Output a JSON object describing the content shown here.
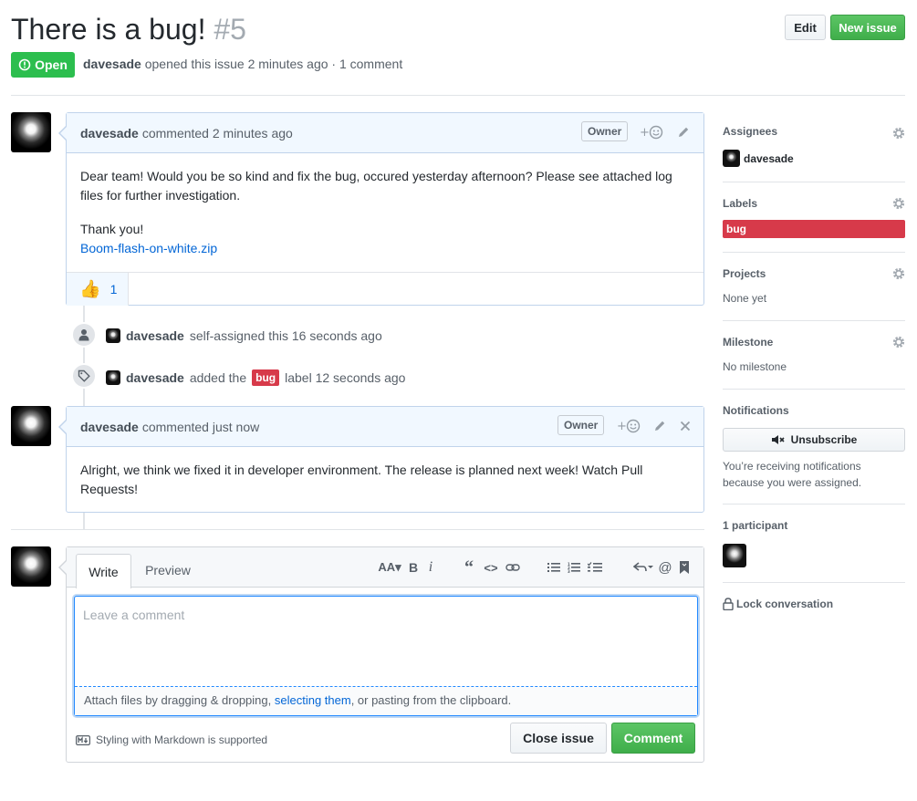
{
  "issue": {
    "title": "There is a bug!",
    "number": "#5",
    "status": "Open",
    "author": "davesade",
    "meta_rest": "opened this issue 2 minutes ago · 1 comment"
  },
  "header_buttons": {
    "edit": "Edit",
    "new_issue": "New issue"
  },
  "comments": [
    {
      "author": "davesade",
      "time": "commented 2 minutes ago",
      "role": "Owner",
      "body_p1": "Dear team! Would you be so kind and fix the bug, occured yesterday afternoon? Please see attached log files for further investigation.",
      "body_p2": "Thank you!",
      "attachment": "Boom-flash-on-white.zip",
      "reaction_emoji": "👍",
      "reaction_count": "1"
    },
    {
      "author": "davesade",
      "time": "commented just now",
      "role": "Owner",
      "body": "Alright, we think we fixed it in developer environment. The release is planned next week! Watch Pull Requests!"
    }
  ],
  "events": [
    {
      "author": "davesade",
      "text": "self-assigned this 16 seconds ago"
    },
    {
      "author": "davesade",
      "before": "added the",
      "label": "bug",
      "after": "label 12 seconds ago"
    }
  ],
  "composer": {
    "tab_write": "Write",
    "tab_preview": "Preview",
    "placeholder": "Leave a comment",
    "attach_before": "Attach files by dragging & dropping, ",
    "attach_link": "selecting them",
    "attach_after": ", or pasting from the clipboard.",
    "markdown_note": "Styling with Markdown is supported",
    "close_button": "Close issue",
    "comment_button": "Comment",
    "toolbar_icons": [
      "text-size-icon",
      "bold-icon",
      "italic-icon",
      "quote-icon",
      "code-icon",
      "link-icon",
      "bulleted-list-icon",
      "numbered-list-icon",
      "task-list-icon",
      "reply-icon",
      "mention-icon",
      "bookmark-icon"
    ]
  },
  "sidebar": {
    "assignees_heading": "Assignees",
    "assignee": "davesade",
    "labels_heading": "Labels",
    "label": "bug",
    "label_color": "#d73a4a",
    "projects_heading": "Projects",
    "projects_value": "None yet",
    "milestone_heading": "Milestone",
    "milestone_value": "No milestone",
    "notifications_heading": "Notifications",
    "unsubscribe": "Unsubscribe",
    "notifications_note": "You’re receiving notifications because you were assigned.",
    "participants_heading": "1 participant",
    "lock": "Lock conversation"
  },
  "colors": {
    "open_green": "#2cbe4e",
    "link_blue": "#0366d6",
    "button_green": "#28a745"
  }
}
